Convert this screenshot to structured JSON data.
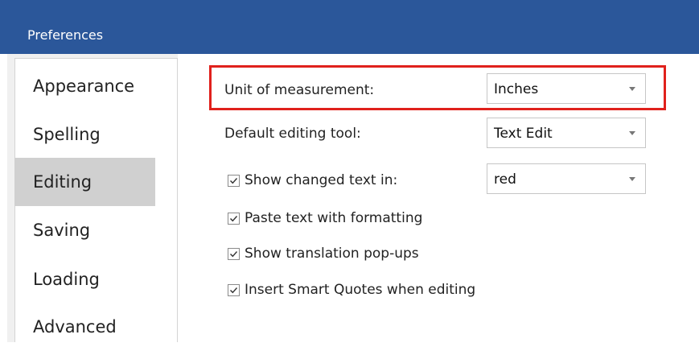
{
  "window": {
    "title": "Preferences"
  },
  "sidebar": {
    "items": [
      {
        "label": "Appearance",
        "selected": false
      },
      {
        "label": "Spelling",
        "selected": false
      },
      {
        "label": "Editing",
        "selected": true
      },
      {
        "label": "Saving",
        "selected": false
      },
      {
        "label": "Loading",
        "selected": false
      },
      {
        "label": "Advanced",
        "selected": false
      }
    ]
  },
  "editing": {
    "unit": {
      "label": "Unit of measurement:",
      "value": "Inches"
    },
    "tool": {
      "label": "Default editing tool:",
      "value": "Text Edit"
    },
    "changed_text": {
      "label": "Show changed text in:",
      "checked": true,
      "value": "red"
    },
    "paste": {
      "label": "Paste text with formatting",
      "checked": true
    },
    "popups": {
      "label": "Show translation pop-ups",
      "checked": true
    },
    "quotes": {
      "label": "Insert Smart Quotes when editing",
      "checked": true
    }
  },
  "colors": {
    "titlebar": "#2b579a",
    "highlight": "#e0211c",
    "selected_nav": "#d0d0d0"
  },
  "icons": {
    "dropdown": "chevron-down-icon",
    "checkbox": "checkmark-icon"
  }
}
